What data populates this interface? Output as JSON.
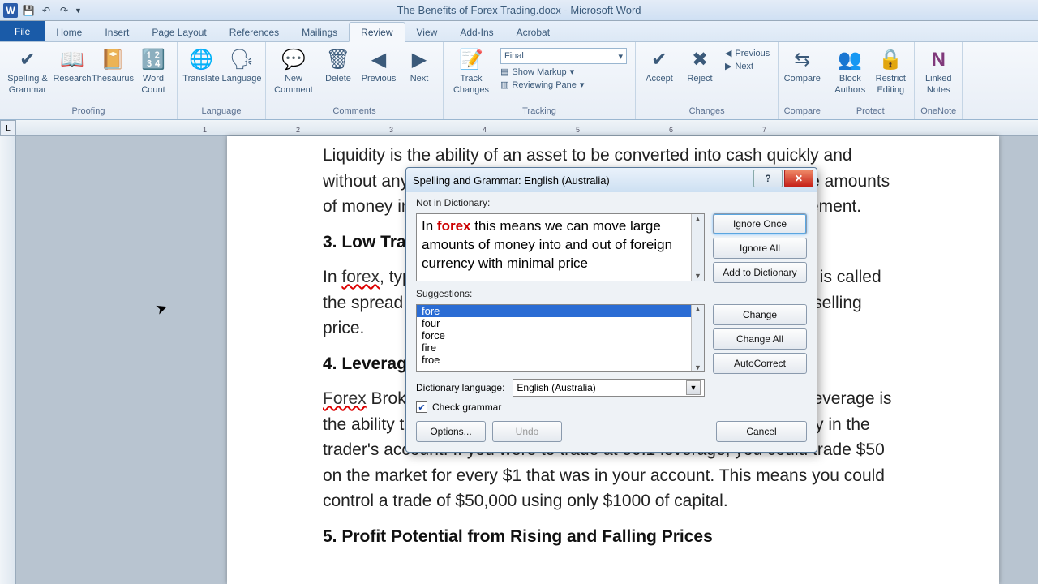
{
  "window": {
    "title": "The Benefits of Forex Trading.docx - Microsoft Word"
  },
  "qat": {
    "app_letter": "W"
  },
  "tabs": {
    "file": "File",
    "home": "Home",
    "insert": "Insert",
    "page_layout": "Page Layout",
    "references": "References",
    "mailings": "Mailings",
    "review": "Review",
    "view": "View",
    "addins": "Add-Ins",
    "acrobat": "Acrobat"
  },
  "ribbon": {
    "proofing": {
      "label": "Proofing",
      "spelling": "Spelling & Grammar",
      "research": "Research",
      "thesaurus": "Thesaurus",
      "wordcount": "Word Count"
    },
    "language": {
      "label": "Language",
      "translate": "Translate",
      "language": "Language"
    },
    "comments": {
      "label": "Comments",
      "new": "New Comment",
      "delete": "Delete",
      "previous": "Previous",
      "next": "Next"
    },
    "tracking": {
      "label": "Tracking",
      "track": "Track Changes",
      "display": "Final",
      "show_markup": "Show Markup",
      "reviewing_pane": "Reviewing Pane"
    },
    "changes": {
      "label": "Changes",
      "accept": "Accept",
      "reject": "Reject",
      "previous": "Previous",
      "next": "Next"
    },
    "compare": {
      "label": "Compare",
      "compare": "Compare"
    },
    "protect": {
      "label": "Protect",
      "block": "Block Authors",
      "restrict": "Restrict Editing"
    },
    "onenote": {
      "label": "OneNote",
      "linked": "Linked Notes"
    }
  },
  "document": {
    "para1": "Liquidity is the ability of an asset to be converted into cash quickly and without any price discount. In forex this means we can move large amounts of money into and out of foreign currency with minimal price movement.",
    "h3": "3. Low Transaction Costs",
    "para2a": "In ",
    "para2_err": "forex",
    "para2b": ", typically the cost for a transaction is built into the price. It is called the spread. The spread is the difference between the buying and selling price.",
    "h4": "4. Leverage",
    "para3a_err": "Forex",
    "para3a": " Brokers allow traders to trade the market using leverage. Leverage is the ability to trade more money on the market than what is actually in the trader's account. If you were to trade at 50:1 leverage, you could trade $50 on the market for every $1 that was in your account. This means you could control a trade of $50,000 using only $1000 of capital.",
    "h5": "5. Profit Potential from Rising and Falling Prices"
  },
  "dialog": {
    "title": "Spelling and Grammar: English (Australia)",
    "not_in_dict_label": "Not in Dictionary:",
    "context_pre": "In ",
    "context_word": "forex",
    "context_post": " this means we can move large amounts of money into and out of foreign currency with minimal price",
    "suggestions_label": "Suggestions:",
    "suggestions": [
      "fore",
      "four",
      "force",
      "fire",
      "froe"
    ],
    "dict_lang_label": "Dictionary language:",
    "dict_lang_value": "English (Australia)",
    "check_grammar": "Check grammar",
    "buttons": {
      "ignore_once": "Ignore Once",
      "ignore_all": "Ignore All",
      "add": "Add to Dictionary",
      "change": "Change",
      "change_all": "Change All",
      "autocorrect": "AutoCorrect",
      "options": "Options...",
      "undo": "Undo",
      "cancel": "Cancel"
    }
  },
  "ruler": {
    "corner": "L",
    "marks": [
      "1",
      "2",
      "3",
      "4",
      "5",
      "6",
      "7"
    ]
  }
}
